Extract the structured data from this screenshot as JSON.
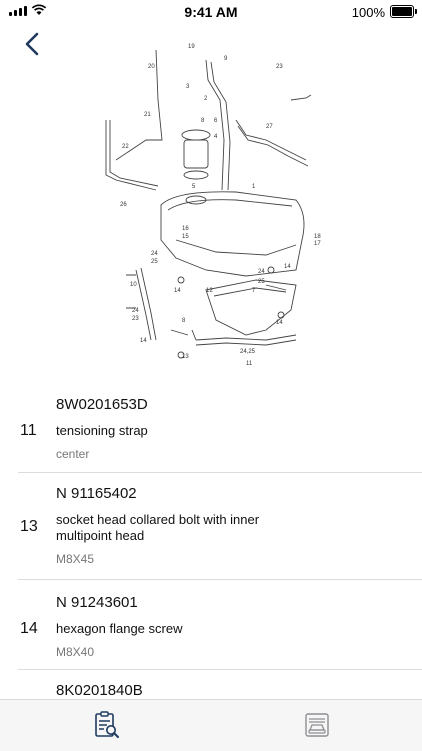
{
  "status_bar": {
    "time": "9:41 AM",
    "battery_percent": "100%"
  },
  "icons": {
    "back": "chevron-left-icon",
    "tab_catalog": "clipboard-search-icon",
    "tab_vehicle": "vehicle-front-icon"
  },
  "colors": {
    "accent": "#1f3a5f",
    "separator": "#dcdcdc",
    "secondary_text": "#777777"
  },
  "diagram": {
    "callouts": [
      "19",
      "20",
      "9",
      "23",
      "3",
      "8",
      "4",
      "21",
      "22",
      "2",
      "6",
      "27",
      "26",
      "5",
      "1",
      "16",
      "15",
      "18",
      "17",
      "24",
      "25",
      "14",
      "10",
      "24",
      "25",
      "14",
      "12",
      "7",
      "24",
      "23",
      "14",
      "8",
      "14",
      "13",
      "24,25",
      "11"
    ]
  },
  "parts": [
    {
      "part_number": "8W0201653D",
      "position": "11",
      "description": "tensioning strap",
      "spec": "center"
    },
    {
      "part_number": "N  91165402",
      "position": "13",
      "description": "socket head collared bolt with inner multipoint head",
      "spec": "M8X45"
    },
    {
      "part_number": "N  91243601",
      "position": "14",
      "description": "hexagon flange screw",
      "spec": "M8X40"
    },
    {
      "part_number": "8K0201840B",
      "position": "",
      "description": "",
      "spec": ""
    }
  ]
}
